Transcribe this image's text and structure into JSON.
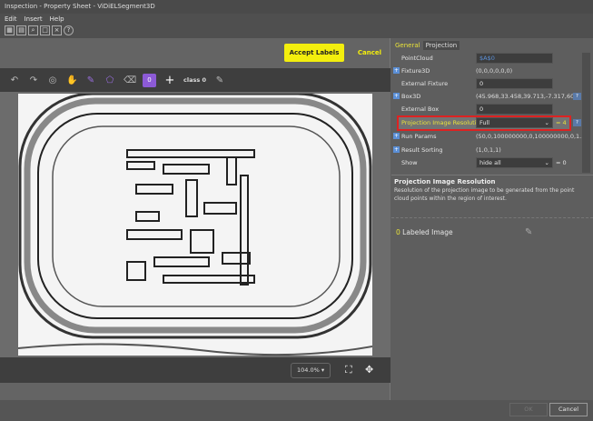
{
  "window": {
    "title": "Inspection - Property Sheet - ViDiELSegment3D"
  },
  "menu": [
    "Edit",
    "Insert",
    "Help"
  ],
  "toolbar_icons": [
    "grid-icon",
    "table-icon",
    "search-icon",
    "zoom-icon",
    "fit-icon",
    "help-icon"
  ],
  "actions": {
    "accept": "Accept Labels",
    "cancel": "Cancel"
  },
  "editor": {
    "class_count": "0",
    "class_name": "class 0"
  },
  "zoom": {
    "value": "104.0%"
  },
  "tabs": [
    "General",
    "Projection"
  ],
  "properties": [
    {
      "label": "PointCloud",
      "value": "$A$0"
    },
    {
      "label": "Fixture3D",
      "value": "(0,0,0,0,0,0)"
    },
    {
      "label": "External Fixture",
      "value": "0"
    },
    {
      "label": "Box3D",
      "value": "(45.968,33.458,39.713,-7.317,60.4..."
    },
    {
      "label": "External Box",
      "value": "0"
    },
    {
      "label": "Projection Image Resolution",
      "value": "Full",
      "suffix": "= 4"
    },
    {
      "label": "Run Params",
      "value": "(50,0,100000000,0,100000000,0,1..."
    },
    {
      "label": "Result Sorting",
      "value": "(1,0,1,1)"
    },
    {
      "label": "Show",
      "value": "hide all",
      "suffix": "= 0"
    }
  ],
  "description": {
    "title": "Projection Image Resolution",
    "text": "Resolution of the projection image to be generated from the point cloud points within the region of interest."
  },
  "labeled": {
    "count": "0",
    "label": "Labeled Image"
  },
  "footer": {
    "ok": "OK",
    "cancel": "Cancel"
  },
  "colors": {
    "accent": "#f3ee0d",
    "highlight": "#d22222",
    "class": "#8c5ad6"
  }
}
